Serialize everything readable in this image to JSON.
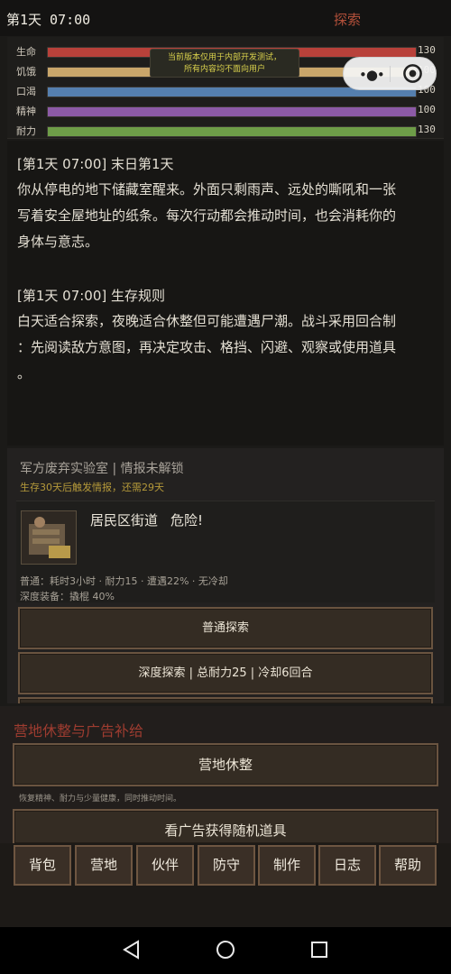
{
  "status_bar": {
    "time": "第1天 07:00",
    "mode": "探索"
  },
  "dev_notice": {
    "line1": "当前版本仅用于内部开发测试，",
    "line2": "所有内容均不面向用户"
  },
  "stats": [
    {
      "label": "生命",
      "value": "130",
      "fill": 1.0,
      "color": "#b8413a"
    },
    {
      "label": "饥饿",
      "value": "100",
      "fill": 1.0,
      "color": "#c9a66a"
    },
    {
      "label": "口渴",
      "value": "100",
      "fill": 1.0,
      "color": "#557fae"
    },
    {
      "label": "精神",
      "value": "100",
      "fill": 1.0,
      "color": "#8c5aa6"
    },
    {
      "label": "耐力",
      "value": "130",
      "fill": 1.0,
      "color": "#6e9d48"
    }
  ],
  "log": [
    {
      "head": "[第1天 07:00] 末日第1天",
      "body": [
        "你从停电的地下储藏室醒来。外面只剩雨声、远处的嘶吼和一张",
        "写着安全屋地址的纸条。每次行动都会推动时间，也会消耗你的",
        "身体与意志。"
      ]
    },
    {
      "head": "[第1天 07:00] 生存规则",
      "body": [
        "白天适合探索，夜晚适合休整但可能遭遇尸潮。战斗采用回合制",
        "：先阅读敌方意图，再决定攻击、格挡、闪避、观察或使用道具",
        "。"
      ]
    }
  ],
  "explore": {
    "location": "军方废弃实验室 | 情报未解锁",
    "location_sub": "生存30天后触发情报，还需29天",
    "area_name": "居民区街道",
    "area_danger": "危险!",
    "normal_meta": "普通：耗时3小时 · 耐力15 · 遭遇22% · 无冷却",
    "deep_meta": "深度装备：撬棍 40%",
    "normal_button": "普通探索",
    "deep_button": "深度探索 | 总耐力25 | 冷却6回合"
  },
  "camp": {
    "title": "营地休整与广告补给",
    "rest_button": "营地休整",
    "rest_note": "恢复精神、耐力与少量健康，同时推动时间。",
    "ad_button": "看广告获得随机道具"
  },
  "nav": [
    "背包",
    "营地",
    "伙伴",
    "防守",
    "制作",
    "日志",
    "帮助"
  ],
  "icons": {
    "capsule_more": "more-dots-icon",
    "capsule_close": "target-close-icon",
    "sys_back": "back-triangle-icon",
    "sys_home": "home-circle-icon",
    "sys_recent": "recent-square-icon"
  }
}
